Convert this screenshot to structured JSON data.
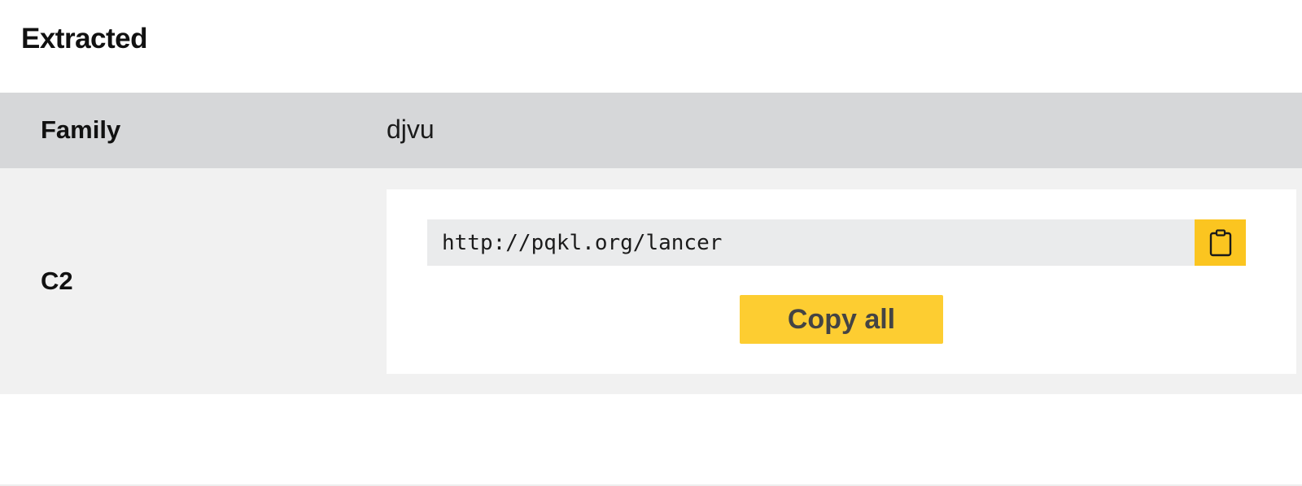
{
  "section": {
    "title": "Extracted"
  },
  "rows": {
    "family": {
      "label": "Family",
      "value": "djvu"
    },
    "c2": {
      "label": "C2",
      "url": "http://pqkl.org/lancer",
      "copy_icon": "clipboard-icon",
      "copy_all_label": "Copy all"
    }
  },
  "colors": {
    "header_row_bg": "#d6d7d9",
    "row_bg": "#f1f1f1",
    "url_box_bg": "#eaebec",
    "accent_yellow": "#fbc520",
    "copy_all_bg": "#fdcd31"
  }
}
